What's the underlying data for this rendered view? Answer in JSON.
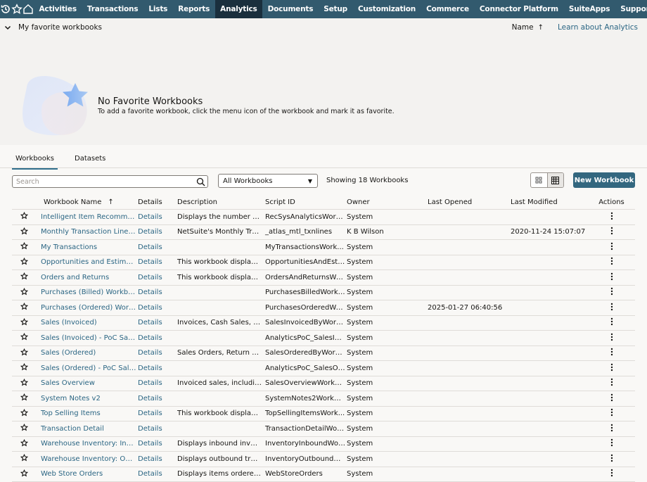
{
  "nav": {
    "icons": [
      "recent-history-icon",
      "favorites-star-icon",
      "home-icon"
    ],
    "items": [
      {
        "label": "Activities"
      },
      {
        "label": "Transactions"
      },
      {
        "label": "Lists"
      },
      {
        "label": "Reports"
      },
      {
        "label": "Analytics",
        "active": true
      },
      {
        "label": "Documents"
      },
      {
        "label": "Setup"
      },
      {
        "label": "Customization"
      },
      {
        "label": "Commerce"
      },
      {
        "label": "Connector Platform"
      },
      {
        "label": "SuiteApps"
      },
      {
        "label": "Support"
      }
    ]
  },
  "favorites": {
    "section_title": "My favorite workbooks",
    "sort_label": "Name",
    "sort_icon": "↑",
    "learn_link": "Learn about Analytics",
    "empty_title": "No Favorite Workbooks",
    "empty_desc": "To add a favorite workbook, click the menu icon of the workbook and mark it as favorite."
  },
  "tabs": [
    {
      "label": "Workbooks",
      "active": true
    },
    {
      "label": "Datasets"
    }
  ],
  "toolbar": {
    "search_placeholder": "Search",
    "filter_value": "All Workbooks",
    "showing": "Showing 18 Workbooks",
    "new_button": "New Workbook"
  },
  "table": {
    "headers": {
      "name": "Workbook Name",
      "name_sort": "↑",
      "details": "Details",
      "description": "Description",
      "script_id": "Script ID",
      "owner": "Owner",
      "last_opened": "Last Opened",
      "last_modified": "Last Modified",
      "actions": "Actions"
    },
    "rows": [
      {
        "name": "Intelligent Item Recommen...",
        "details": "Details",
        "description": "Displays the number an...",
        "script_id": "RecSysAnalyticsWork...",
        "owner": "System",
        "last_opened": "",
        "last_modified": ""
      },
      {
        "name": "Monthly Transaction Lines ...",
        "details": "Details",
        "description": "NetSuite's Monthly Tran...",
        "script_id": "_atlas_mtl_txnlines",
        "owner": "K B Wilson",
        "last_opened": "",
        "last_modified": "2020-11-24 15:07:07"
      },
      {
        "name": "My Transactions",
        "details": "Details",
        "description": "",
        "script_id": "MyTransactionsWork...",
        "owner": "System",
        "last_opened": "",
        "last_modified": ""
      },
      {
        "name": "Opportunities and Estimates",
        "details": "Details",
        "description": "This workbook displays ...",
        "script_id": "OpportunitiesAndEsti...",
        "owner": "System",
        "last_opened": "",
        "last_modified": ""
      },
      {
        "name": "Orders and Returns",
        "details": "Details",
        "description": "This workbook displays ...",
        "script_id": "OrdersAndReturnsWo...",
        "owner": "System",
        "last_opened": "",
        "last_modified": ""
      },
      {
        "name": "Purchases (Billed) Workbook",
        "details": "Details",
        "description": "",
        "script_id": "PurchasesBilledWorkb...",
        "owner": "System",
        "last_opened": "",
        "last_modified": ""
      },
      {
        "name": "Purchases (Ordered) Workb...",
        "details": "Details",
        "description": "",
        "script_id": "PurchasesOrderedWo...",
        "owner": "System",
        "last_opened": "2025-01-27 06:40:56",
        "last_modified": ""
      },
      {
        "name": "Sales (Invoiced)",
        "details": "Details",
        "description": "Invoices, Cash Sales, Cas...",
        "script_id": "SalesInvoicedByWork...",
        "owner": "System",
        "last_opened": "",
        "last_modified": ""
      },
      {
        "name": "Sales (Invoiced) - PoC Sales ...",
        "details": "Details",
        "description": "",
        "script_id": "AnalyticsPoC_SalesIn...",
        "owner": "System",
        "last_opened": "",
        "last_modified": ""
      },
      {
        "name": "Sales (Ordered)",
        "details": "Details",
        "description": "Sales Orders, Return Aut...",
        "script_id": "SalesOrderedByWork...",
        "owner": "System",
        "last_opened": "",
        "last_modified": ""
      },
      {
        "name": "Sales (Ordered) - PoC Sales ...",
        "details": "Details",
        "description": "",
        "script_id": "AnalyticsPoC_SalesOr...",
        "owner": "System",
        "last_opened": "",
        "last_modified": ""
      },
      {
        "name": "Sales Overview",
        "details": "Details",
        "description": "Invoiced sales, including...",
        "script_id": "SalesOverviewWorkbo...",
        "owner": "System",
        "last_opened": "",
        "last_modified": ""
      },
      {
        "name": "System Notes v2",
        "details": "Details",
        "description": "",
        "script_id": "SystemNotes2Workbo...",
        "owner": "System",
        "last_opened": "",
        "last_modified": ""
      },
      {
        "name": "Top Selling Items",
        "details": "Details",
        "description": "This workbook displays t...",
        "script_id": "TopSellingItemsWork...",
        "owner": "System",
        "last_opened": "",
        "last_modified": ""
      },
      {
        "name": "Transaction Detail",
        "details": "Details",
        "description": "",
        "script_id": "TransactionDetailWor...",
        "owner": "System",
        "last_opened": "",
        "last_modified": ""
      },
      {
        "name": "Warehouse Inventory: Inbo...",
        "details": "Details",
        "description": "Displays inbound invent...",
        "script_id": "InventoryInboundWor...",
        "owner": "System",
        "last_opened": "",
        "last_modified": ""
      },
      {
        "name": "Warehouse Inventory: Outb...",
        "details": "Details",
        "description": "Displays outbound trans...",
        "script_id": "InventoryOutboundW...",
        "owner": "System",
        "last_opened": "",
        "last_modified": ""
      },
      {
        "name": "Web Store Orders",
        "details": "Details",
        "description": "Displays items ordered t...",
        "script_id": "WebStoreOrders",
        "owner": "System",
        "last_opened": "",
        "last_modified": ""
      }
    ]
  }
}
